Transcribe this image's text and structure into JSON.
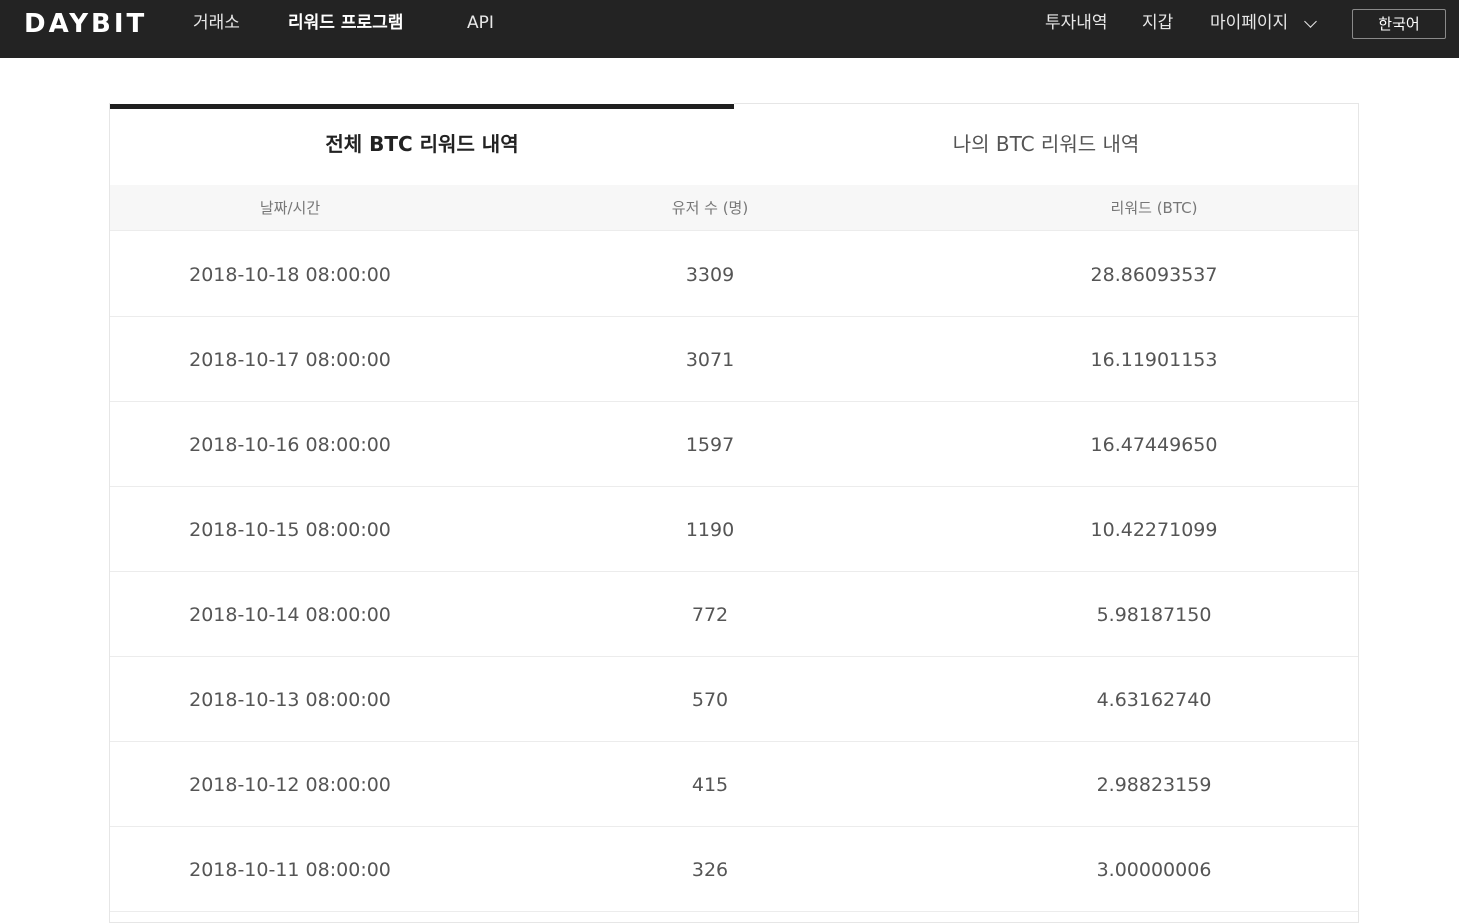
{
  "header": {
    "logo": "DAYBIT",
    "nav": [
      "거래소",
      "리워드 프로그램",
      "API"
    ],
    "right_nav": [
      "투자내역",
      "지갑",
      "마이페이지"
    ],
    "language": "한국어"
  },
  "tabs": [
    "전체 BTC 리워드 내역",
    "나의 BTC 리워드 내역"
  ],
  "table": {
    "columns": [
      "날짜/시간",
      "유저 수 (명)",
      "리워드 (BTC)"
    ],
    "rows": [
      [
        "2018-10-18 08:00:00",
        "3309",
        "28.86093537"
      ],
      [
        "2018-10-17 08:00:00",
        "3071",
        "16.11901153"
      ],
      [
        "2018-10-16 08:00:00",
        "1597",
        "16.47449650"
      ],
      [
        "2018-10-15 08:00:00",
        "1190",
        "10.42271099"
      ],
      [
        "2018-10-14 08:00:00",
        "772",
        "5.98187150"
      ],
      [
        "2018-10-13 08:00:00",
        "570",
        "4.63162740"
      ],
      [
        "2018-10-12 08:00:00",
        "415",
        "2.98823159"
      ],
      [
        "2018-10-11 08:00:00",
        "326",
        "3.00000006"
      ]
    ]
  },
  "colors": {
    "header_bg": "#232323",
    "tab_indicator": "#1f1f1f",
    "table_head_bg": "#f7f7f7"
  }
}
